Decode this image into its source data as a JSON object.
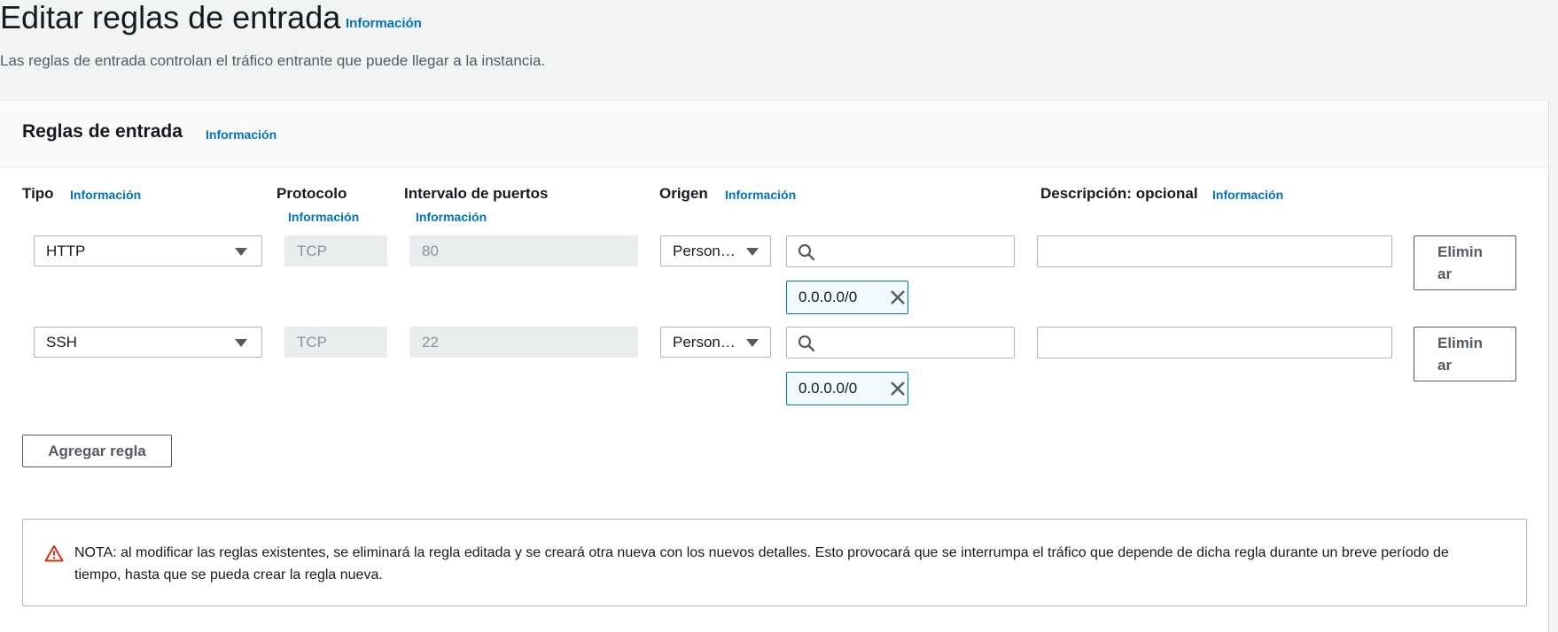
{
  "header": {
    "title": "Editar reglas de entrada",
    "info_label": "Información",
    "description": "Las reglas de entrada controlan el tráfico entrante que puede llegar a la instancia."
  },
  "section": {
    "title": "Reglas de entrada",
    "info_label": "Información"
  },
  "columns": {
    "tipo": "Tipo",
    "tipo_info": "Información",
    "protocolo": "Protocolo",
    "protocolo_info": "Información",
    "puertos": "Intervalo de puertos",
    "puertos_info": "Información",
    "origen": "Origen",
    "origen_info": "Información",
    "descripcion": "Descripción: opcional",
    "descripcion_info": "Información"
  },
  "rules": [
    {
      "type": "HTTP",
      "protocol": "TCP",
      "port_range": "80",
      "source_type": "Person…",
      "search_value": "",
      "cidr": "0.0.0.0/0",
      "description": "",
      "remove_label_1": "Elimin",
      "remove_label_2": "ar"
    },
    {
      "type": "SSH",
      "protocol": "TCP",
      "port_range": "22",
      "source_type": "Person…",
      "search_value": "",
      "cidr": "0.0.0.0/0",
      "description": "",
      "remove_label_1": "Elimin",
      "remove_label_2": "ar"
    }
  ],
  "add_rule_label": "Agregar regla",
  "alert": {
    "icon": "warning-icon",
    "text": "NOTA: al modificar las reglas existentes, se eliminará la regla editada y se creará otra nueva con los nuevos detalles. Esto provocará que se interrumpa el tráfico que depende de dicha regla durante un breve período de tiempo, hasta que se pueda crear la regla nueva."
  },
  "colors": {
    "link": "#0073bb",
    "token_border": "#0073bb",
    "warning": "#d13212"
  }
}
